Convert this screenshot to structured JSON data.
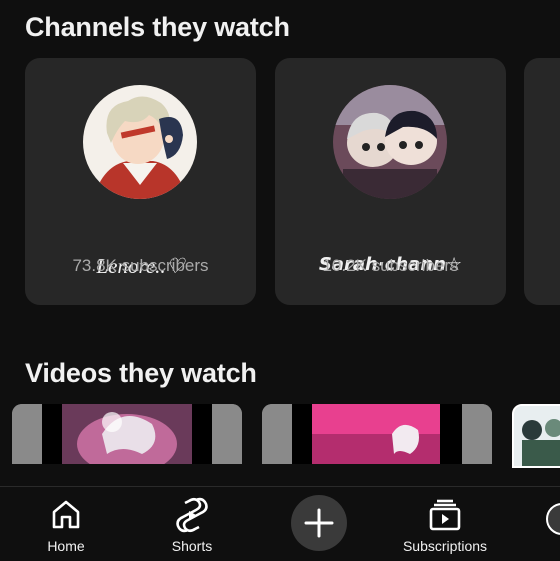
{
  "sections": {
    "channels_title": "Channels they watch",
    "videos_title": "Videos they watch"
  },
  "channels": [
    {
      "name": "Lenore..♡",
      "subscribers": "73.8K subscribers"
    },
    {
      "name": "Sarah·chann☆",
      "subscribers": "10.2K subscribers"
    }
  ],
  "bottom_nav": {
    "home": "Home",
    "shorts": "Shorts",
    "create": "+",
    "subscriptions": "Subscriptions"
  },
  "icons": {
    "home": "home-icon",
    "shorts": "shorts-icon",
    "create": "plus-icon",
    "subscriptions": "subscriptions-icon",
    "you": "avatar"
  },
  "colors": {
    "background": "#0f0f0f",
    "card": "#272727",
    "secondary_text": "#aaaaaa",
    "thumb_pink": "#e8408f"
  }
}
